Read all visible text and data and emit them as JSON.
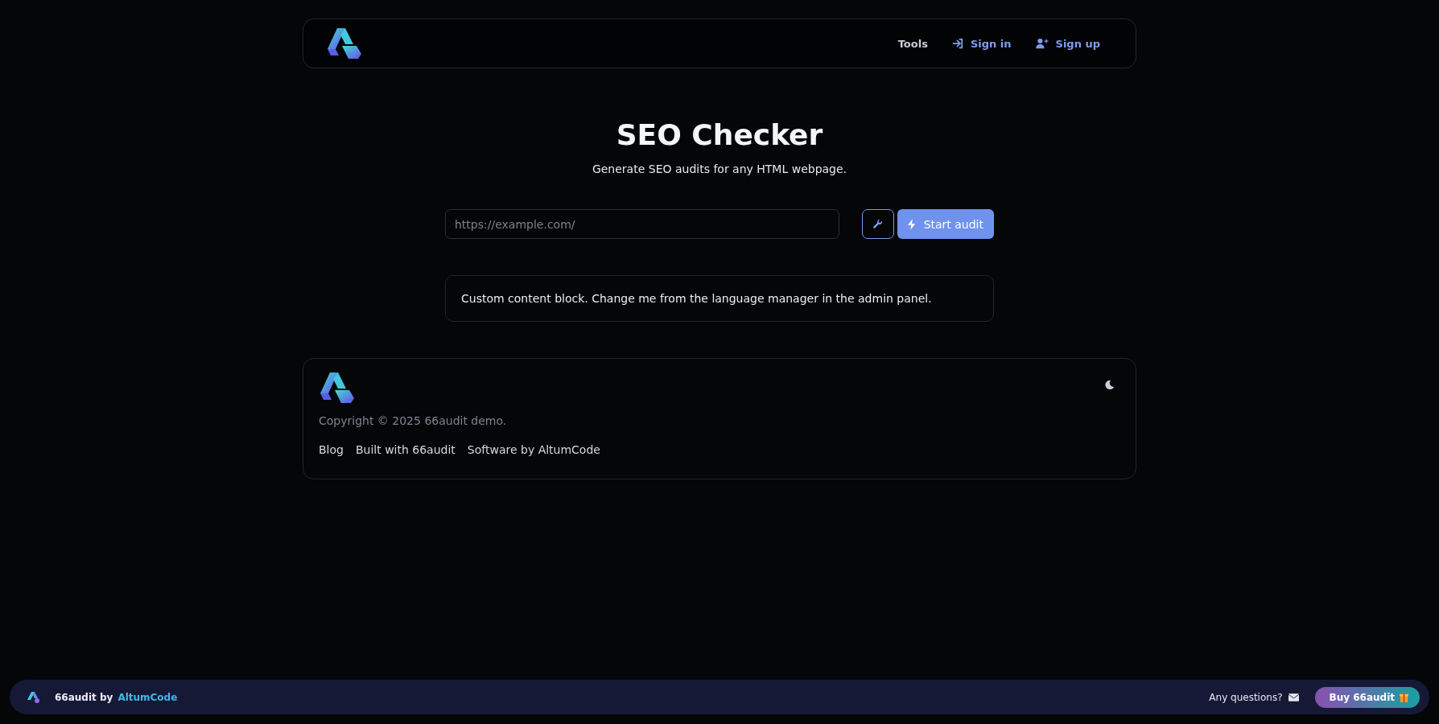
{
  "header": {
    "nav": [
      {
        "label": "Tools",
        "kind": "plain"
      },
      {
        "label": "Sign in",
        "kind": "signin"
      },
      {
        "label": "Sign up",
        "kind": "signup"
      }
    ]
  },
  "hero": {
    "title": "SEO Checker",
    "subtitle": "Generate SEO audits for any HTML webpage."
  },
  "audit_form": {
    "url_field": {
      "placeholder": "https://example.com/"
    },
    "submit": "Start audit"
  },
  "content_block": "Custom content block. Change me from the language manager in the admin panel.",
  "footer": {
    "copyright": "Copyright © 2025 66audit demo.",
    "links": [
      "Blog",
      "Built with 66audit",
      "Software by AltumCode"
    ]
  },
  "promo_bar": {
    "product": "66audit by",
    "author": "AltumCode",
    "question": "Any questions?",
    "buy": "Buy 66audit"
  }
}
